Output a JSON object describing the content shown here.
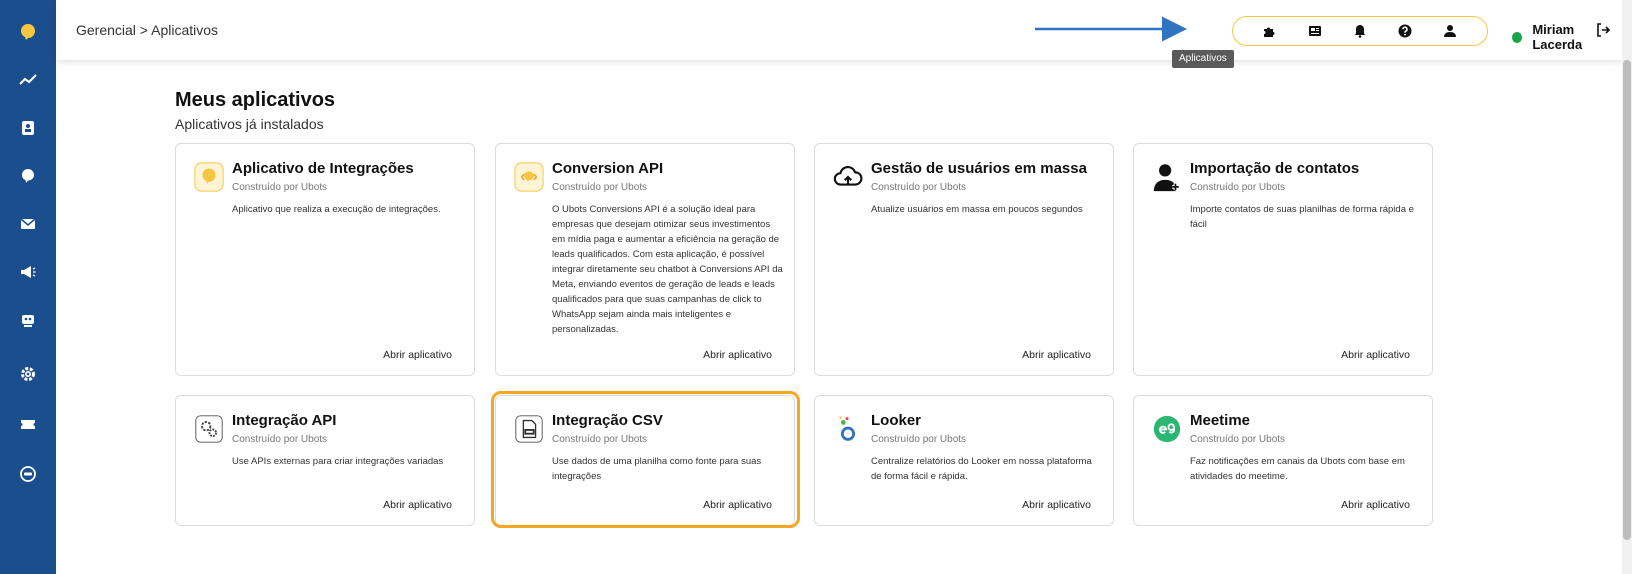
{
  "topbar": {
    "breadcrumb": "Gerencial > Aplicativos",
    "user_name": "Miriam Lacerda",
    "tooltip": "Aplicativos",
    "icons": [
      "puzzle-icon",
      "newspaper-icon",
      "bell-icon",
      "help-icon",
      "user-icon"
    ]
  },
  "sidebar": {
    "items": [
      "logo-icon",
      "trend-icon",
      "contact-icon",
      "bot-icon",
      "mail-icon",
      "megaphone-icon",
      "robot-icon",
      "gear-icon",
      "ticket-icon",
      "api-icon"
    ]
  },
  "main": {
    "title": "Meus aplicativos",
    "subtitle": "Aplicativos já instalados",
    "cards": [
      {
        "title": "Aplicativo de Integrações",
        "by": "Construído por Ubots",
        "desc": "Aplicativo que realiza a execução de integrações.",
        "link": "Abrir aplicativo"
      },
      {
        "title": "Conversion API",
        "by": "Construído por Ubots",
        "desc": "O Ubots Conversions API é a solução ideal para empresas que desejam otimizar seus investimentos em mídia paga e aumentar a eficiência na geração de leads qualificados. Com esta aplicação, é possível integrar diretamente seu chatbot à Conversions API da Meta, enviando eventos de geração de leads e leads qualificados para que suas campanhas de click to WhatsApp sejam ainda mais inteligentes e personalizadas.",
        "link": "Abrir aplicativo"
      },
      {
        "title": "Gestão de usuários em massa",
        "by": "Construído por Ubots",
        "desc": "Atualize usuários em massa em poucos segundos",
        "link": "Abrir aplicativo"
      },
      {
        "title": "Importação de contatos",
        "by": "Construído por Ubots",
        "desc": "Importe contatos de suas planilhas de forma rápida e fácil",
        "link": "Abrir aplicativo"
      },
      {
        "title": "Integração API",
        "by": "Construído por Ubots",
        "desc": "Use APIs externas para criar integrações variadas",
        "link": "Abrir aplicativo"
      },
      {
        "title": "Integração CSV",
        "by": "Construído por Ubots",
        "desc": "Use dados de uma planilha como fonte para suas integrações",
        "link": "Abrir aplicativo"
      },
      {
        "title": "Looker",
        "by": "Construído por Ubots",
        "desc": "Centralize relatórios do Looker em nossa plataforma de forma fácil e rápida.",
        "link": "Abrir aplicativo"
      },
      {
        "title": "Meetime",
        "by": "Construído por Ubots",
        "desc": "Faz notificações em canais da Ubots com base em atividades do meetime.",
        "link": "Abrir aplicativo"
      }
    ]
  },
  "colors": {
    "sidebar": "#1b4e8d",
    "accent_yellow": "#f5c642",
    "highlight_orange": "#f5a623",
    "arrow_blue": "#2f74c0",
    "online_green": "#1aa34a"
  }
}
